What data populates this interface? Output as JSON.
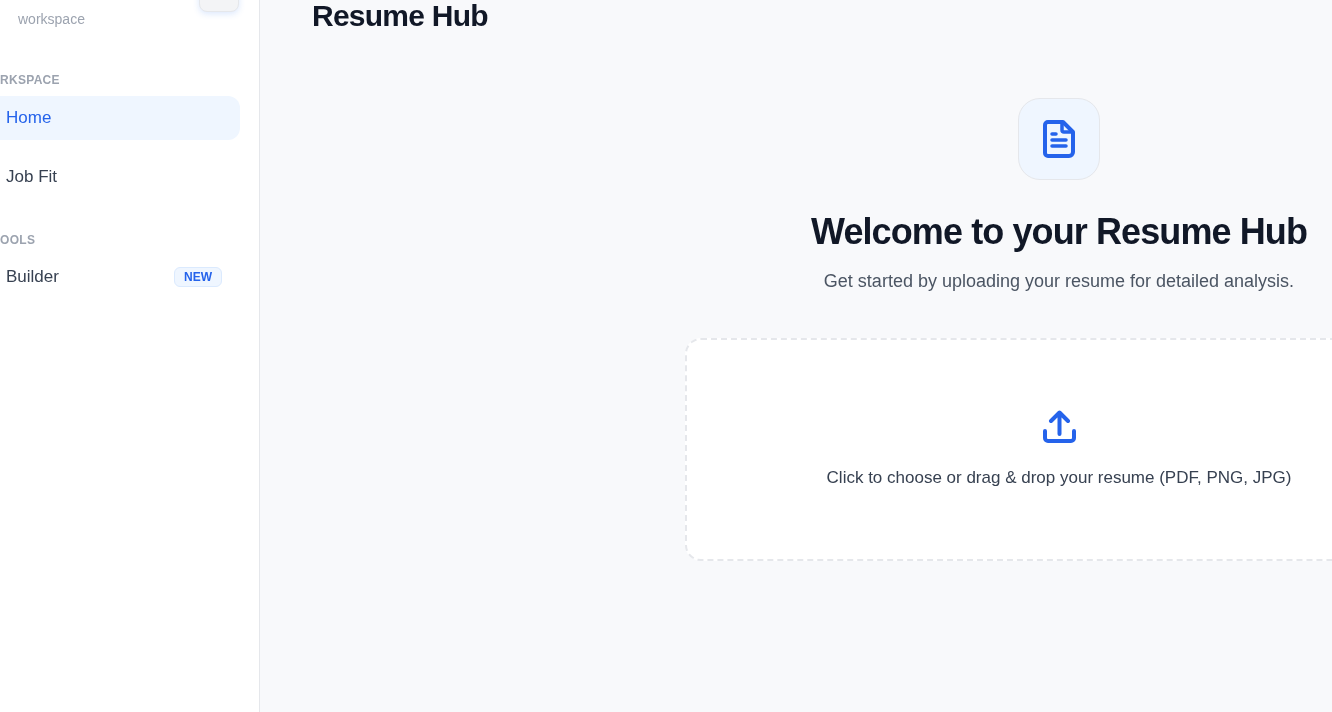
{
  "sidebar": {
    "header": {
      "subtitle": "workspace"
    },
    "sections": [
      {
        "label": "RKSPACE",
        "items": [
          {
            "label": "Home",
            "selected": true
          },
          {
            "label": "Job Fit",
            "selected": false
          }
        ]
      },
      {
        "label": "OOLS",
        "items": [
          {
            "label": "Builder",
            "selected": false,
            "badge": "NEW"
          }
        ]
      }
    ]
  },
  "main": {
    "title": "Resume Hub",
    "welcome": {
      "heading": "Welcome to your Resume Hub",
      "subtitle": "Get started by uploading your resume for detailed analysis."
    },
    "dropzone": {
      "text": "Click to choose or drag & drop your resume (PDF, PNG, JPG)"
    }
  }
}
